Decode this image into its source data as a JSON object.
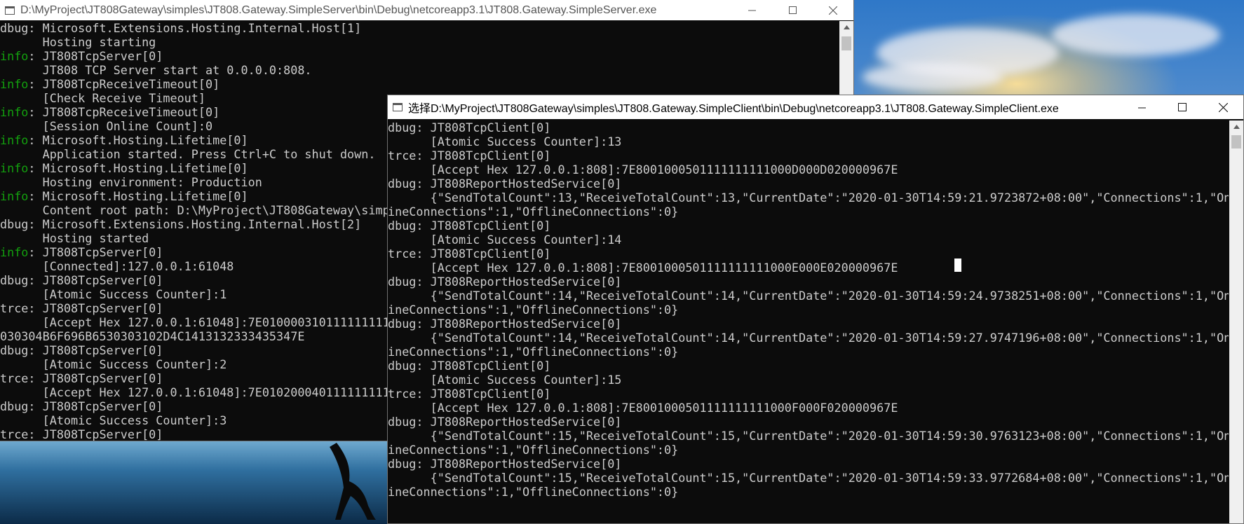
{
  "server_window": {
    "title": "D:\\MyProject\\JT808Gateway\\simples\\JT808.Gateway.SimpleServer\\bin\\Debug\\netcoreapp3.1\\JT808.Gateway.SimpleServer.exe",
    "lines": [
      {
        "lvl": "dbug",
        "text": "dbug: Microsoft.Extensions.Hosting.Internal.Host[1]"
      },
      {
        "lvl": "",
        "text": "      Hosting starting"
      },
      {
        "lvl": "info",
        "lvl_text": "info",
        "rest": ": JT808TcpServer[0]"
      },
      {
        "lvl": "",
        "text": "      JT808 TCP Server start at 0.0.0.0:808."
      },
      {
        "lvl": "info",
        "lvl_text": "info",
        "rest": ": JT808TcpReceiveTimeout[0]"
      },
      {
        "lvl": "",
        "text": "      [Check Receive Timeout]"
      },
      {
        "lvl": "info",
        "lvl_text": "info",
        "rest": ": JT808TcpReceiveTimeout[0]"
      },
      {
        "lvl": "",
        "text": "      [Session Online Count]:0"
      },
      {
        "lvl": "info",
        "lvl_text": "info",
        "rest": ": Microsoft.Hosting.Lifetime[0]"
      },
      {
        "lvl": "",
        "text": "      Application started. Press Ctrl+C to shut down."
      },
      {
        "lvl": "info",
        "lvl_text": "info",
        "rest": ": Microsoft.Hosting.Lifetime[0]"
      },
      {
        "lvl": "",
        "text": "      Hosting environment: Production"
      },
      {
        "lvl": "info",
        "lvl_text": "info",
        "rest": ": Microsoft.Hosting.Lifetime[0]"
      },
      {
        "lvl": "",
        "text": "      Content root path: D:\\MyProject\\JT808Gateway\\simp"
      },
      {
        "lvl": "dbug",
        "text": "dbug: Microsoft.Extensions.Hosting.Internal.Host[2]"
      },
      {
        "lvl": "",
        "text": "      Hosting started"
      },
      {
        "lvl": "info",
        "lvl_text": "info",
        "rest": ": JT808TcpServer[0]"
      },
      {
        "lvl": "",
        "text": "      [Connected]:127.0.0.1:61048"
      },
      {
        "lvl": "dbug",
        "text": "dbug: JT808TcpServer[0]"
      },
      {
        "lvl": "",
        "text": "      [Atomic Success Counter]:1"
      },
      {
        "lvl": "trce",
        "text": "trce: JT808TcpServer[0]"
      },
      {
        "lvl": "",
        "text": "      [Accept Hex 127.0.0.1:61048]:7E0100003101111111111"
      },
      {
        "lvl": "",
        "text": "030304B6F696B6530303102D4C1413132333435347E"
      },
      {
        "lvl": "dbug",
        "text": "dbug: JT808TcpServer[0]"
      },
      {
        "lvl": "",
        "text": "      [Atomic Success Counter]:2"
      },
      {
        "lvl": "trce",
        "text": "trce: JT808TcpServer[0]"
      },
      {
        "lvl": "",
        "text": "      [Accept Hex 127.0.0.1:61048]:7E0102000401111111111"
      },
      {
        "lvl": "dbug",
        "text": "dbug: JT808TcpServer[0]"
      },
      {
        "lvl": "",
        "text": "      [Atomic Success Counter]:3"
      },
      {
        "lvl": "trce",
        "text": "trce: JT808TcpServer[0]"
      }
    ]
  },
  "client_window": {
    "title": "选择D:\\MyProject\\JT808Gateway\\simples\\JT808.Gateway.SimpleClient\\bin\\Debug\\netcoreapp3.1\\JT808.Gateway.SimpleClient.exe",
    "lines": [
      {
        "lvl": "dbug",
        "text": "dbug: JT808TcpClient[0]"
      },
      {
        "lvl": "",
        "text": "      [Atomic Success Counter]:13"
      },
      {
        "lvl": "trce",
        "text": "trce: JT808TcpClient[0]"
      },
      {
        "lvl": "",
        "text": "      [Accept Hex 127.0.0.1:808]:7E8001000501111111111000D000D020000967E"
      },
      {
        "lvl": "dbug",
        "text": "dbug: JT808ReportHostedService[0]"
      },
      {
        "lvl": "",
        "text": "      {\"SendTotalCount\":13,\"ReceiveTotalCount\":13,\"CurrentDate\":\"2020-01-30T14:59:21.9723872+08:00\",\"Connections\":1,\"Onl"
      },
      {
        "lvl": "",
        "text": "ineConnections\":1,\"OfflineConnections\":0}"
      },
      {
        "lvl": "dbug",
        "text": "dbug: JT808TcpClient[0]"
      },
      {
        "lvl": "",
        "text": "      [Atomic Success Counter]:14"
      },
      {
        "lvl": "trce",
        "text": "trce: JT808TcpClient[0]"
      },
      {
        "lvl": "",
        "text": "      [Accept Hex 127.0.0.1:808]:7E8001000501111111111000E000E020000967E"
      },
      {
        "lvl": "dbug",
        "text": "dbug: JT808ReportHostedService[0]"
      },
      {
        "lvl": "",
        "text": "      {\"SendTotalCount\":14,\"ReceiveTotalCount\":14,\"CurrentDate\":\"2020-01-30T14:59:24.9738251+08:00\",\"Connections\":1,\"Onl"
      },
      {
        "lvl": "",
        "text": "ineConnections\":1,\"OfflineConnections\":0}"
      },
      {
        "lvl": "dbug",
        "text": "dbug: JT808ReportHostedService[0]"
      },
      {
        "lvl": "",
        "text": "      {\"SendTotalCount\":14,\"ReceiveTotalCount\":14,\"CurrentDate\":\"2020-01-30T14:59:27.9747196+08:00\",\"Connections\":1,\"Onl"
      },
      {
        "lvl": "",
        "text": "ineConnections\":1,\"OfflineConnections\":0}"
      },
      {
        "lvl": "dbug",
        "text": "dbug: JT808TcpClient[0]"
      },
      {
        "lvl": "",
        "text": "      [Atomic Success Counter]:15"
      },
      {
        "lvl": "trce",
        "text": "trce: JT808TcpClient[0]"
      },
      {
        "lvl": "",
        "text": "      [Accept Hex 127.0.0.1:808]:7E8001000501111111111000F000F020000967E"
      },
      {
        "lvl": "dbug",
        "text": "dbug: JT808ReportHostedService[0]"
      },
      {
        "lvl": "",
        "text": "      {\"SendTotalCount\":15,\"ReceiveTotalCount\":15,\"CurrentDate\":\"2020-01-30T14:59:30.9763123+08:00\",\"Connections\":1,\"Onl"
      },
      {
        "lvl": "",
        "text": "ineConnections\":1,\"OfflineConnections\":0}"
      },
      {
        "lvl": "dbug",
        "text": "dbug: JT808ReportHostedService[0]"
      },
      {
        "lvl": "",
        "text": "      {\"SendTotalCount\":15,\"ReceiveTotalCount\":15,\"CurrentDate\":\"2020-01-30T14:59:33.9772684+08:00\",\"Connections\":1,\"Onl"
      },
      {
        "lvl": "",
        "text": "ineConnections\":1,\"OfflineConnections\":0}"
      }
    ]
  },
  "colors": {
    "console_bg": "#0c0c0c",
    "console_text": "#cccccc",
    "info_level": "#13a10e",
    "titlebar_bg": "#ffffff"
  },
  "icons": [
    "console-app-icon",
    "minimize-icon",
    "maximize-icon",
    "close-icon",
    "scroll-up-arrow-icon"
  ]
}
